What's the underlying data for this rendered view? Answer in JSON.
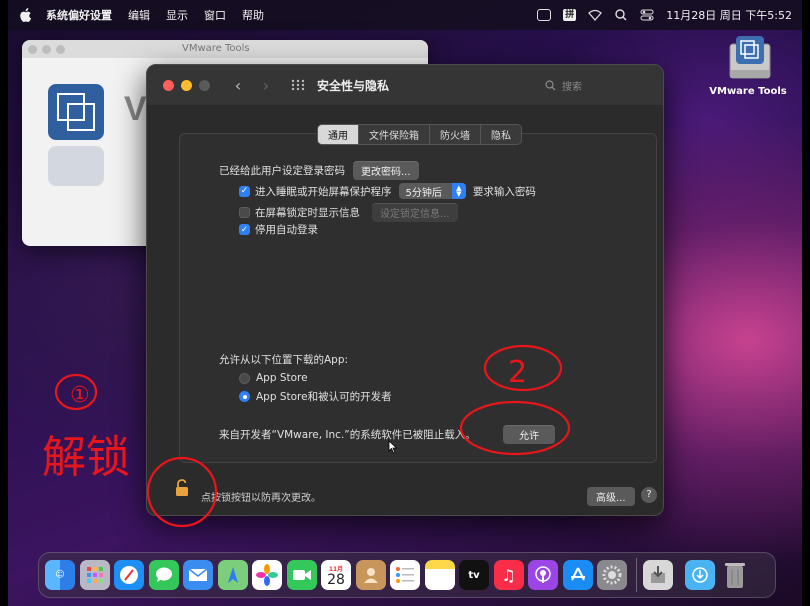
{
  "menubar": {
    "app_name": "系统偏好设置",
    "menus": [
      "编辑",
      "显示",
      "窗口",
      "帮助"
    ],
    "clock": "11月28日 周日 下午5:52",
    "ime_label": "拼"
  },
  "desktop": {
    "disk_label": "VMware Tools"
  },
  "vmware_window": {
    "title": "VMware Tools",
    "partial_heading": "V"
  },
  "prefs_window": {
    "title": "安全性与隐私",
    "search_placeholder": "搜索",
    "tabs": [
      {
        "label": "通用",
        "active": true
      },
      {
        "label": "文件保险箱",
        "active": false
      },
      {
        "label": "防火墙",
        "active": false
      },
      {
        "label": "隐私",
        "active": false
      }
    ],
    "general": {
      "password_set_text": "已经给此用户设定登录密码",
      "change_password_button": "更改密码...",
      "require_password": {
        "checked": true,
        "prefix": "进入睡眠或开始屏幕保护程序",
        "delay_value": "5分钟后",
        "suffix": "要求输入密码"
      },
      "show_message": {
        "checked": false,
        "label": "在屏幕锁定时显示信息",
        "button": "设定锁定信息..."
      },
      "disable_autologin": {
        "checked": true,
        "label": "停用自动登录"
      },
      "allow_apps_heading": "允许从以下位置下载的App:",
      "radio_options": [
        {
          "label": "App Store",
          "selected": false
        },
        {
          "label": "App Store和被认可的开发者",
          "selected": true
        }
      ],
      "blocked_message": "来自开发者“VMware, Inc.”的系统软件已被阻止载入。",
      "allow_button": "允许"
    },
    "lock_text": "点按锁按钮以防再次更改。",
    "advanced_button": "高级...",
    "help_button": "?"
  },
  "annotations": {
    "step1_label": "①",
    "step1_text": "解锁",
    "step2_label": "2"
  },
  "dock": {
    "calendar_month": "11月",
    "calendar_day": "28",
    "tv_label": "tv",
    "apps": [
      "finder",
      "launchpad",
      "safari",
      "messages",
      "mail",
      "maps",
      "photos",
      "facetime",
      "calendar",
      "contacts",
      "reminders",
      "notes",
      "tv",
      "music",
      "podcasts",
      "app-store",
      "system-preferences",
      "installer",
      "downloads",
      "trash"
    ]
  },
  "colors": {
    "accent": "#2f7ff5",
    "annotation_red": "#e8161b",
    "window_bg": "#2b2b2b"
  }
}
